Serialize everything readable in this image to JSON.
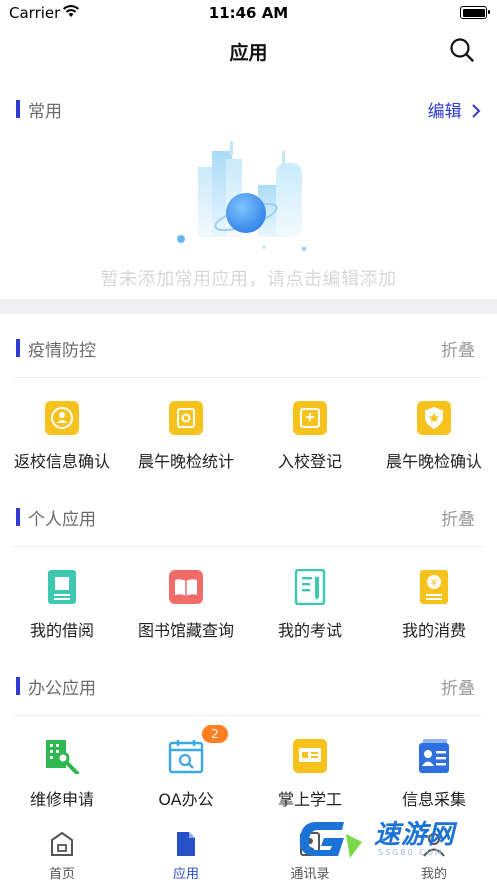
{
  "status_bar": {
    "carrier": "Carrier",
    "time": "11:46 AM"
  },
  "nav": {
    "title": "应用"
  },
  "favorites": {
    "title": "常用",
    "edit_label": "编辑",
    "empty_text": "暂未添加常用应用，请点击编辑添加"
  },
  "sections": [
    {
      "title": "疫情防控",
      "action": "折叠",
      "apps": [
        {
          "label": "返校信息确认",
          "icon": "return-school-confirm-icon",
          "color": "#f7c21c"
        },
        {
          "label": "晨午晚检统计",
          "icon": "check-statistics-icon",
          "color": "#f7c21c"
        },
        {
          "label": "入校登记",
          "icon": "school-entry-register-icon",
          "color": "#f7c21c"
        },
        {
          "label": "晨午晚检确认",
          "icon": "check-confirm-shield-icon",
          "color": "#f7c21c"
        }
      ]
    },
    {
      "title": "个人应用",
      "action": "折叠",
      "apps": [
        {
          "label": "我的借阅",
          "icon": "book-borrow-icon",
          "color": "#3ec8b0"
        },
        {
          "label": "图书馆藏查询",
          "icon": "library-search-icon",
          "color": "#f26b6b"
        },
        {
          "label": "我的考试",
          "icon": "exam-icon",
          "color": "#3ec8b0"
        },
        {
          "label": "我的消费",
          "icon": "consumption-icon",
          "color": "#f7c21c"
        }
      ]
    },
    {
      "title": "办公应用",
      "action": "折叠",
      "apps": [
        {
          "label": "维修申请",
          "icon": "repair-request-icon",
          "color": "#2fb84f"
        },
        {
          "label": "OA办公",
          "icon": "oa-calendar-icon",
          "color": "#3ba7e6",
          "badge": "2"
        },
        {
          "label": "掌上学工",
          "icon": "student-work-icon",
          "color": "#f7c21c"
        },
        {
          "label": "信息采集",
          "icon": "info-collect-icon",
          "color": "#2f6fe0"
        }
      ]
    }
  ],
  "tabs": [
    {
      "label": "首页",
      "icon": "home-icon"
    },
    {
      "label": "应用",
      "icon": "apps-document-icon",
      "active": true
    },
    {
      "label": "通讯录",
      "icon": "contacts-icon"
    },
    {
      "label": "我的",
      "icon": "profile-icon"
    }
  ],
  "watermark": {
    "text": "速游网",
    "sub": "SSG80.COM"
  },
  "colors": {
    "accent": "#2f3bd1",
    "tab_active": "#2851c8",
    "badge": "#ff7e1f"
  }
}
